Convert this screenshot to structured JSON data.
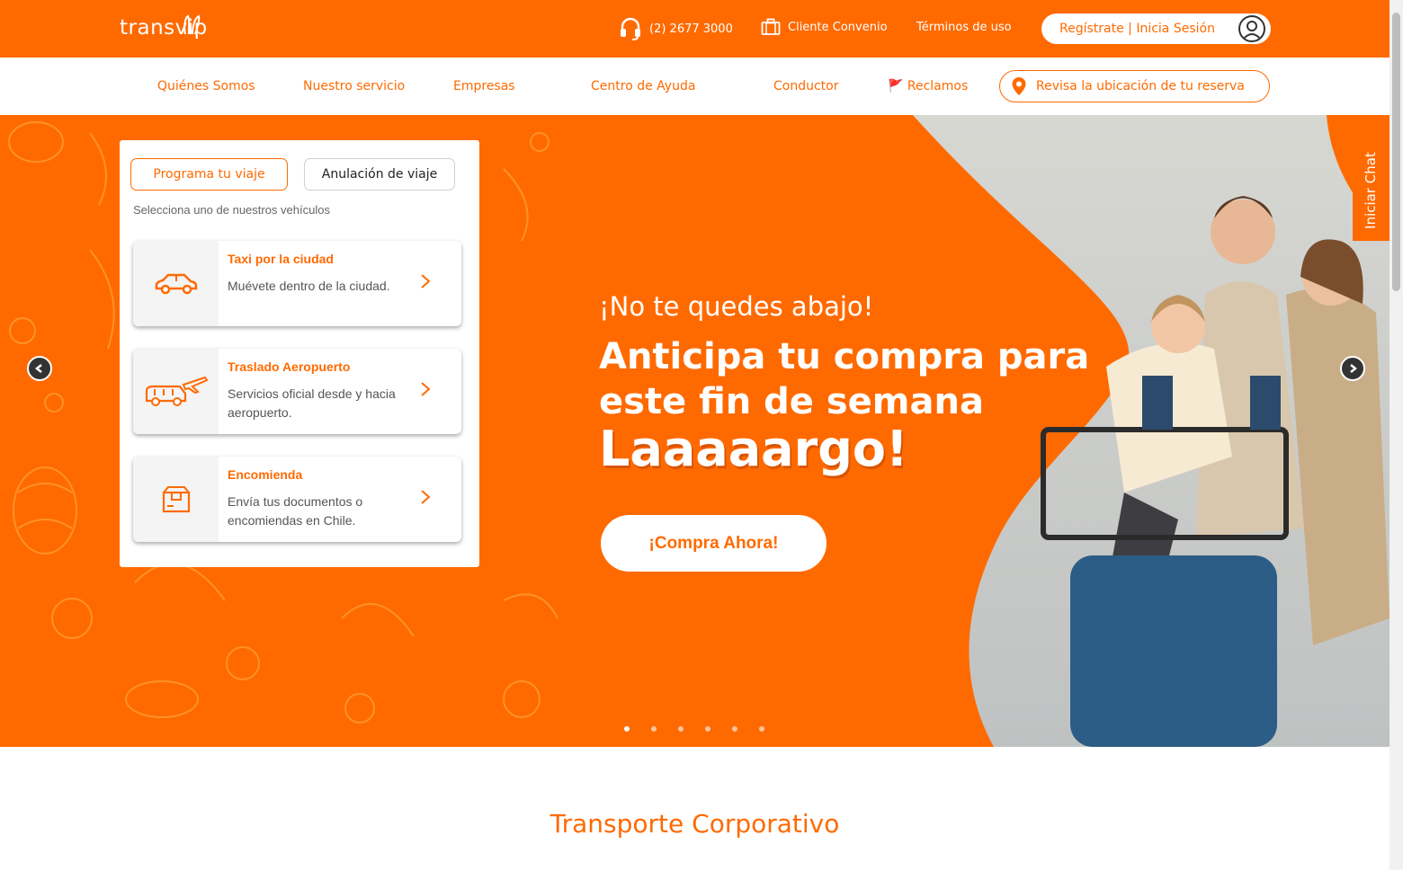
{
  "header": {
    "logo": "transvip",
    "phone": "(2) 2677 3000",
    "cliente_convenio": "Cliente Convenio",
    "terminos": "Términos de uso",
    "login": "Regístrate | Inicia Sesión"
  },
  "nav": {
    "items": [
      "Quiénes Somos",
      "Nuestro servicio",
      "Empresas",
      "Centro de Ayuda",
      "Conductor",
      "🚩 Reclamos"
    ],
    "reserva_button": "Revisa la ubicación de tu reserva"
  },
  "booking": {
    "tabs": [
      "Programa tu viaje",
      "Anulación de viaje"
    ],
    "select_label": "Selecciona uno de nuestros vehículos",
    "vehicles": [
      {
        "title": "Taxi por la ciudad",
        "desc": "Muévete dentro de la ciudad.",
        "icon": "car-icon"
      },
      {
        "title": "Traslado Aeropuerto",
        "desc": "Servicios oficial desde y hacia aeropuerto.",
        "icon": "van-plane-icon"
      },
      {
        "title": "Encomienda",
        "desc": "Envía tus documentos o encomiendas en Chile.",
        "icon": "box-icon"
      }
    ]
  },
  "slide": {
    "subtitle": "¡No te quedes abajo!",
    "headline": "Anticipa tu compra para este fin de semana",
    "largo": "Laaaaargo!",
    "cta": "¡Compra Ahora!",
    "dots_count": 6,
    "active_dot": 0
  },
  "chat": "Iniciar Chat",
  "section": {
    "title": "Transporte Corporativo"
  },
  "colors": {
    "accent": "#ff6a00",
    "text": "#222222"
  }
}
